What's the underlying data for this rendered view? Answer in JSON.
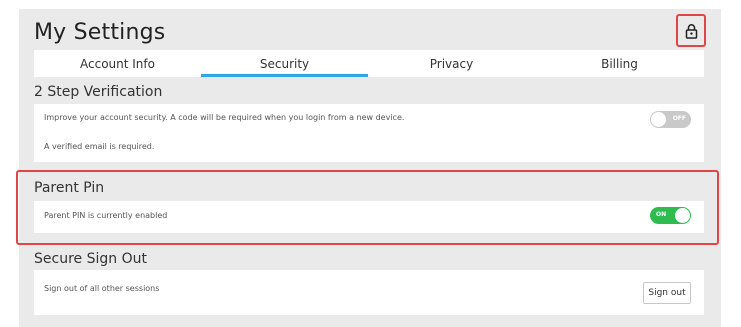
{
  "page": {
    "title": "My Settings",
    "lock_icon": "lock-icon"
  },
  "tabs": [
    {
      "label": "Account Info",
      "active": false
    },
    {
      "label": "Security",
      "active": true
    },
    {
      "label": "Privacy",
      "active": false
    },
    {
      "label": "Billing",
      "active": false
    }
  ],
  "two_step": {
    "title": "2 Step Verification",
    "description": "Improve your account security. A code will be required when you login from a new device.",
    "note": "A verified email is required.",
    "toggle_label": "OFF",
    "enabled": false
  },
  "parent_pin": {
    "title": "Parent Pin",
    "description": "Parent PIN is currently enabled",
    "toggle_label": "ON",
    "enabled": true
  },
  "secure_signout": {
    "title": "Secure Sign Out",
    "description": "Sign out of all other sessions",
    "button_label": "Sign out"
  },
  "colors": {
    "accent": "#2ea7e6",
    "toggle_on": "#2ebc4f",
    "toggle_off": "#c9c9c9",
    "highlight": "#e04548",
    "panel_bg": "#eaeaea"
  }
}
